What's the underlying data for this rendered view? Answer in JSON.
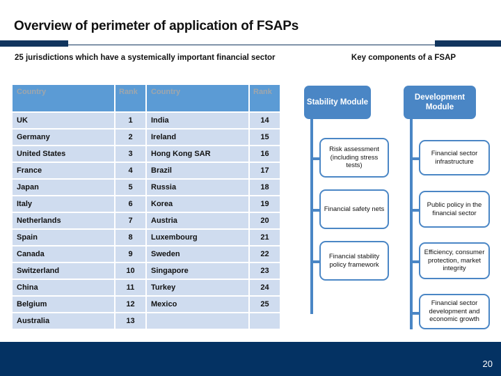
{
  "slide": {
    "title": "Overview of perimeter of application of FSAPs",
    "page_number": "20"
  },
  "left_panel": {
    "subtitle": "25 jurisdictions which have a systemically important financial sector",
    "table": {
      "headers": [
        "Country",
        "Rank",
        "Country",
        "Rank"
      ],
      "rows": [
        [
          "UK",
          "1",
          "India",
          "14"
        ],
        [
          "Germany",
          "2",
          "Ireland",
          "15"
        ],
        [
          "United States",
          "3",
          "Hong Kong SAR",
          "16"
        ],
        [
          "France",
          "4",
          "Brazil",
          "17"
        ],
        [
          "Japan",
          "5",
          "Russia",
          "18"
        ],
        [
          "Italy",
          "6",
          "Korea",
          "19"
        ],
        [
          "Netherlands",
          "7",
          "Austria",
          "20"
        ],
        [
          "Spain",
          "8",
          "Luxembourg",
          "21"
        ],
        [
          "Canada",
          "9",
          "Sweden",
          "22"
        ],
        [
          "Switzerland",
          "10",
          "Singapore",
          "23"
        ],
        [
          "China",
          "11",
          "Turkey",
          "24"
        ],
        [
          "Belgium",
          "12",
          "Mexico",
          "25"
        ],
        [
          "Australia",
          "13",
          "",
          ""
        ]
      ]
    }
  },
  "right_panel": {
    "subtitle": "Key components of a FSAP",
    "modules": [
      {
        "name": "Stability Module",
        "components": [
          "Risk assessment (including stress tests)",
          "Financial safety nets",
          "Financial stability policy framework"
        ]
      },
      {
        "name": "Development Module",
        "components": [
          "Financial sector infrastructure",
          "Public policy in the financial sector",
          "Efficiency, consumer protection, market integrity",
          "Financial sector development and economic growth"
        ]
      }
    ]
  },
  "colors": {
    "navy": "#11355e",
    "footer_navy": "#043263",
    "module_blue": "#4a86c5",
    "table_header_blue": "#5b9bd5",
    "table_cell_blue": "#cfdcef"
  }
}
